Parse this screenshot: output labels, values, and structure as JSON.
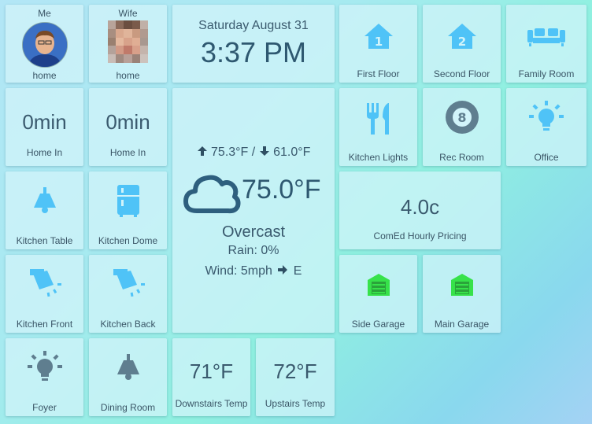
{
  "presence": [
    {
      "title": "Me",
      "state": "home"
    },
    {
      "title": "Wife",
      "state": "home"
    }
  ],
  "clock": {
    "date": "Saturday August 31",
    "time": "3:37 PM"
  },
  "rooms_top": [
    {
      "label": "First Floor",
      "icon": "house-one-icon"
    },
    {
      "label": "Second Floor",
      "icon": "house-two-icon"
    },
    {
      "label": "Family Room",
      "icon": "sofa-icon"
    }
  ],
  "eta": [
    {
      "value": "0min",
      "label": "Home In"
    },
    {
      "value": "0min",
      "label": "Home In"
    }
  ],
  "weather": {
    "high": "75.3°F /",
    "low": "61.0°F",
    "temp": "75.0°F",
    "condition": "Overcast",
    "rain": "Rain: 0%",
    "wind": "Wind: 5mph",
    "wind_dir": "E"
  },
  "rooms_mid": [
    {
      "label": "Kitchen Lights",
      "icon": "fork-knife-icon"
    },
    {
      "label": "Rec Room",
      "icon": "eight-ball-icon"
    },
    {
      "label": "Office",
      "icon": "lightbulb-icon"
    }
  ],
  "lights": [
    {
      "label": "Kitchen Table",
      "icon": "pendant-lamp-icon"
    },
    {
      "label": "Kitchen Dome",
      "icon": "fridge-icon"
    },
    {
      "label": "Kitchen Front",
      "icon": "spotlight-icon"
    },
    {
      "label": "Kitchen Back",
      "icon": "spotlight-icon"
    },
    {
      "label": "Foyer",
      "icon": "lightbulb-icon"
    },
    {
      "label": "Dining Room",
      "icon": "pendant-lamp-icon"
    }
  ],
  "pricing": {
    "value": "4.0c",
    "label": "ComEd Hourly Pricing"
  },
  "garages": [
    {
      "label": "Side Garage",
      "icon": "garage-icon"
    },
    {
      "label": "Main Garage",
      "icon": "garage-icon"
    }
  ],
  "temps": [
    {
      "value": "71°F",
      "label": "Downstairs Temp"
    },
    {
      "value": "72°F",
      "label": "Upstairs Temp"
    }
  ],
  "colors": {
    "active_icon": "#4fc3f7",
    "inactive_icon": "#5f7e8f",
    "garage_icon": "#37e24a",
    "text": "#3a5566"
  }
}
